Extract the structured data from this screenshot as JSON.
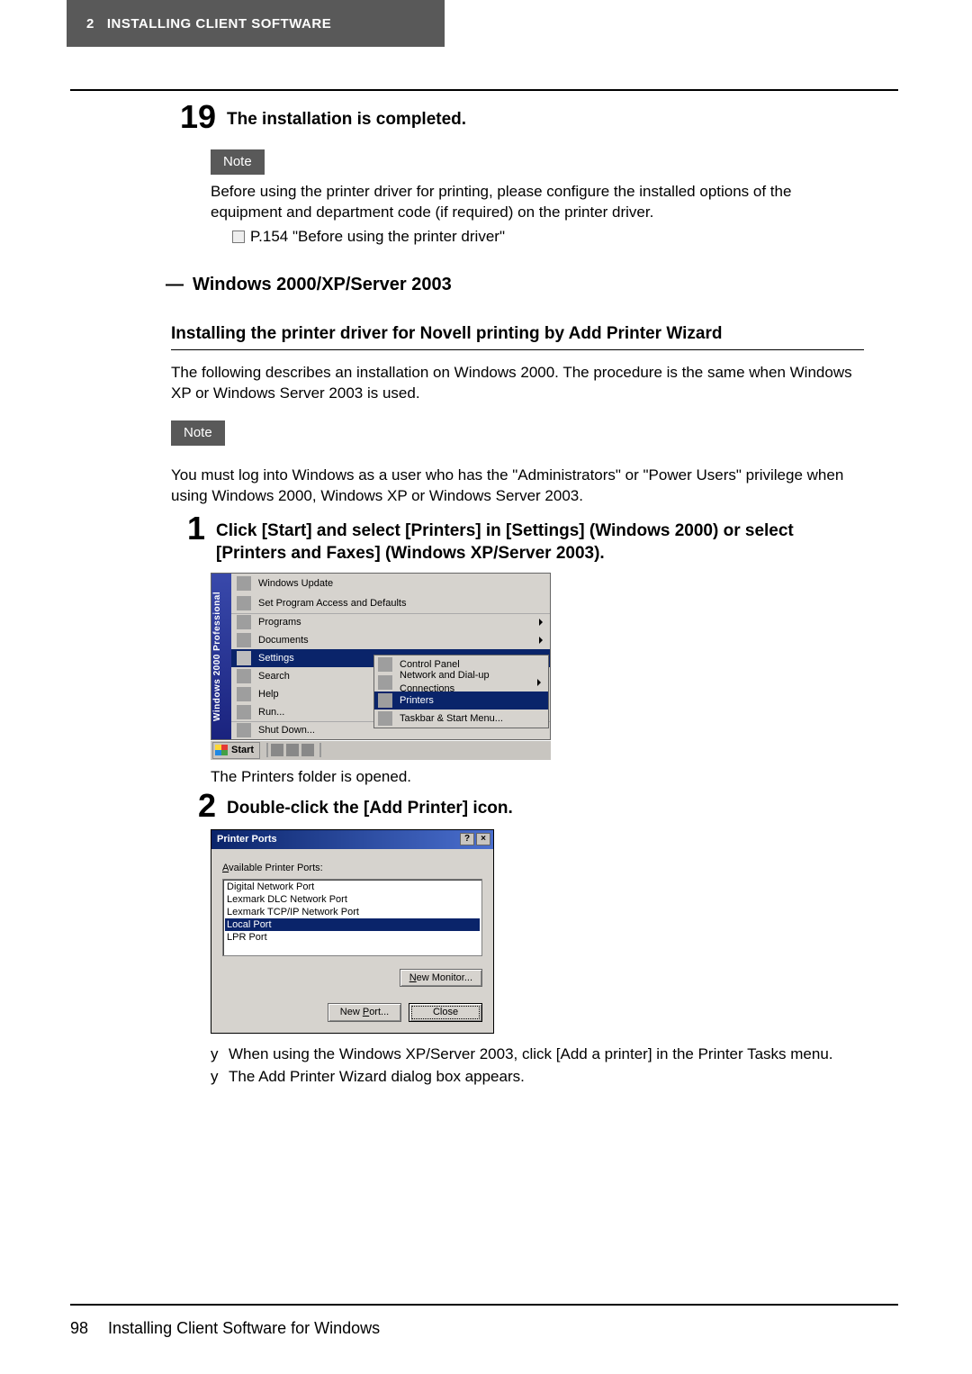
{
  "header": {
    "chapter_number": "2",
    "chapter_title": "INSTALLING CLIENT SOFTWARE"
  },
  "step19": {
    "number": "19",
    "title": "The installation is completed.",
    "note_label": "Note",
    "note_text_line1": "Before using the printer driver for printing, please configure the installed options of the equipment and department code (if required) on the printer driver.",
    "note_ref": "P.154 \"Before using the printer driver\""
  },
  "section": {
    "prefix": "—",
    "title": "Windows 2000/XP/Server 2003"
  },
  "subsection": {
    "title": "Installing the printer driver for Novell printing by Add Printer Wizard",
    "intro": "The following describes an installation on Windows 2000.  The procedure is the same when Windows XP or Windows Server 2003 is used.",
    "note_label": "Note",
    "note_text": "You must log into Windows as a user who has the \"Administrators\" or \"Power Users\" privilege when using Windows 2000, Windows XP or Windows Server 2003."
  },
  "step1": {
    "number": "1",
    "title": "Click [Start] and select [Printers] in [Settings] (Windows 2000) or select [Printers and Faxes] (Windows XP/Server 2003).",
    "after": "The Printers folder is opened."
  },
  "startmenu": {
    "sideband": "Windows 2000 Professional",
    "items": [
      "Windows Update",
      "Set Program Access and Defaults",
      "Programs",
      "Documents",
      "Settings",
      "Search",
      "Help",
      "Run...",
      "Shut Down..."
    ],
    "submenu": [
      "Control Panel",
      "Network and Dial-up Connections",
      "Printers",
      "Taskbar & Start Menu..."
    ],
    "start_btn": "Start"
  },
  "step2": {
    "number": "2",
    "title": "Double-click the [Add Printer] icon."
  },
  "dialog": {
    "title": "Printer Ports",
    "help_btn": "?",
    "close_btn": "×",
    "label_prefix": "A",
    "label_rest": "vailable Printer Ports:",
    "items": [
      "Digital Network Port",
      "Lexmark DLC Network Port",
      "Lexmark TCP/IP Network Port",
      "Local Port",
      "LPR Port"
    ],
    "selected_index": 3,
    "btn_new_monitor_prefix": "N",
    "btn_new_monitor_rest": "ew Monitor...",
    "btn_new_port_pre": "New ",
    "btn_new_port_ul": "P",
    "btn_new_port_post": "ort...",
    "btn_close": "Close"
  },
  "step2_bullets": [
    "When using the Windows XP/Server 2003, click [Add a printer] in the Printer Tasks menu.",
    "The Add Printer Wizard dialog box appears."
  ],
  "bullet_mark": "y",
  "footer": {
    "page": "98",
    "title": "Installing Client Software for Windows"
  }
}
